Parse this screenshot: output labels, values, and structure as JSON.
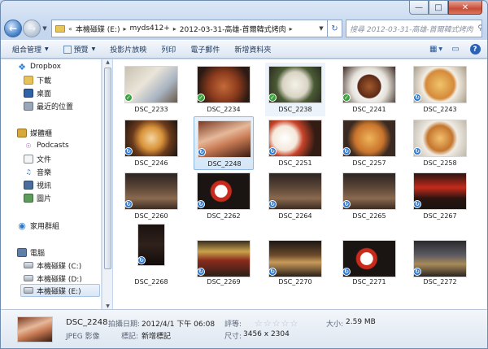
{
  "address": {
    "crumbs": [
      "本機磁碟 (E:)",
      "myds412+",
      "2012-03-31-高雄-首爾韓式烤肉"
    ],
    "search_placeholder": "搜尋 2012-03-31-高雄-首爾韓式烤肉"
  },
  "toolbar": {
    "organize": "組合管理",
    "preview": "預覽",
    "slideshow": "投影片放映",
    "print": "列印",
    "email": "電子郵件",
    "new_folder": "新增資料夾"
  },
  "sidebar": {
    "items": [
      {
        "label": "Dropbox"
      },
      {
        "label": "下載"
      },
      {
        "label": "桌面"
      },
      {
        "label": "最近的位置"
      },
      {
        "label": "媒體櫃"
      },
      {
        "label": "Podcasts"
      },
      {
        "label": "文件"
      },
      {
        "label": "音樂"
      },
      {
        "label": "視訊"
      },
      {
        "label": "圖片"
      },
      {
        "label": "家用群組"
      },
      {
        "label": "電腦"
      },
      {
        "label": "本機磁碟 (C:)"
      },
      {
        "label": "本機磁碟 (D:)"
      },
      {
        "label": "本機磁碟 (E:)"
      }
    ]
  },
  "files": [
    {
      "name": "DSC_2233",
      "status": "synced"
    },
    {
      "name": "DSC_2234",
      "status": "synced"
    },
    {
      "name": "DSC_2238",
      "status": "synced"
    },
    {
      "name": "DSC_2241",
      "status": "synced"
    },
    {
      "name": "DSC_2243",
      "status": "syncing"
    },
    {
      "name": "DSC_2246",
      "status": "syncing"
    },
    {
      "name": "DSC_2248",
      "status": "syncing"
    },
    {
      "name": "DSC_2251",
      "status": "syncing"
    },
    {
      "name": "DSC_2257",
      "status": "syncing"
    },
    {
      "name": "DSC_2258",
      "status": "syncing"
    },
    {
      "name": "DSC_2260",
      "status": "syncing"
    },
    {
      "name": "DSC_2262",
      "status": "syncing"
    },
    {
      "name": "DSC_2264",
      "status": "syncing"
    },
    {
      "name": "DSC_2265",
      "status": "syncing"
    },
    {
      "name": "DSC_2267",
      "status": "syncing"
    },
    {
      "name": "DSC_2268",
      "status": "syncing"
    },
    {
      "name": "DSC_2269",
      "status": "syncing"
    },
    {
      "name": "DSC_2270",
      "status": "syncing"
    },
    {
      "name": "DSC_2271",
      "status": "syncing"
    },
    {
      "name": "DSC_2272",
      "status": "syncing"
    }
  ],
  "details": {
    "name": "DSC_2248",
    "type": "JPEG 影像",
    "date_label": "拍攝日期:",
    "date_value": "2012/4/1 下午 06:08",
    "tags_label": "標記:",
    "tags_value": "新增標記",
    "rating_label": "評等:",
    "rating_value": 0,
    "dims_label": "尺寸:",
    "dims_value": "3456 x 2304",
    "size_label": "大小:",
    "size_value": "2.59 MB"
  },
  "colors": {
    "synced_badge": "#37a33a",
    "sync_badge": "#2f79d0",
    "selection": "#d4e6f7"
  }
}
